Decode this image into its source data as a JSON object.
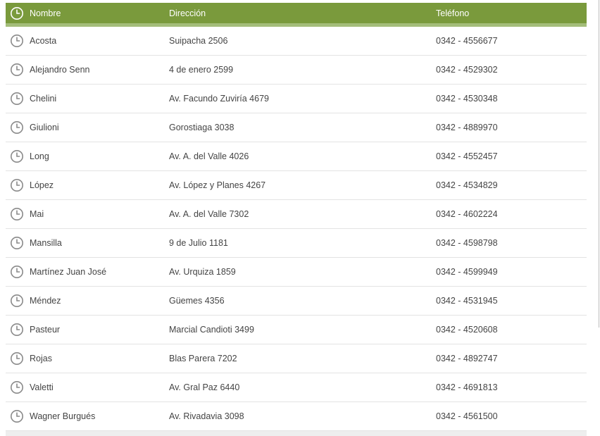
{
  "colors": {
    "header_bg": "#7a9a3c",
    "header_accent": "#a4bd7a",
    "row_text": "#444444",
    "divider": "#e3e3e3"
  },
  "header": {
    "icon": "clock-icon",
    "name": "Nombre",
    "address": "Dirección",
    "phone": "Teléfono"
  },
  "rows": [
    {
      "icon": "clock-icon",
      "name": "Acosta",
      "address": "Suipacha 2506",
      "phone": "0342 - 4556677"
    },
    {
      "icon": "clock-icon",
      "name": "Alejandro Senn",
      "address": "4 de enero 2599",
      "phone": "0342 - 4529302"
    },
    {
      "icon": "clock-icon",
      "name": "Chelini",
      "address": "Av. Facundo Zuviría 4679",
      "phone": "0342 - 4530348"
    },
    {
      "icon": "clock-icon",
      "name": "Giulioni",
      "address": "Gorostiaga 3038",
      "phone": "0342 - 4889970"
    },
    {
      "icon": "clock-icon",
      "name": "Long",
      "address": "Av. A. del Valle 4026",
      "phone": "0342 - 4552457"
    },
    {
      "icon": "clock-icon",
      "name": "López",
      "address": "Av. López y Planes 4267",
      "phone": "0342 - 4534829"
    },
    {
      "icon": "clock-icon",
      "name": "Mai",
      "address": "Av. A. del Valle 7302",
      "phone": "0342 - 4602224"
    },
    {
      "icon": "clock-icon",
      "name": "Mansilla",
      "address": "9 de Julio 1181",
      "phone": "0342 - 4598798"
    },
    {
      "icon": "clock-icon",
      "name": "Martínez Juan José",
      "address": "Av. Urquiza 1859",
      "phone": "0342 - 4599949"
    },
    {
      "icon": "clock-icon",
      "name": "Méndez",
      "address": "Güemes 4356",
      "phone": "0342 - 4531945"
    },
    {
      "icon": "clock-icon",
      "name": "Pasteur",
      "address": "Marcial Candioti 3499",
      "phone": "0342 - 4520608"
    },
    {
      "icon": "clock-icon",
      "name": "Rojas",
      "address": "Blas Parera 7202",
      "phone": "0342 - 4892747"
    },
    {
      "icon": "clock-icon",
      "name": "Valetti",
      "address": "Av. Gral Paz 6440",
      "phone": "0342 - 4691813"
    },
    {
      "icon": "clock-icon",
      "name": "Wagner Burgués",
      "address": "Av. Rivadavia 3098",
      "phone": "0342 - 4561500"
    }
  ]
}
